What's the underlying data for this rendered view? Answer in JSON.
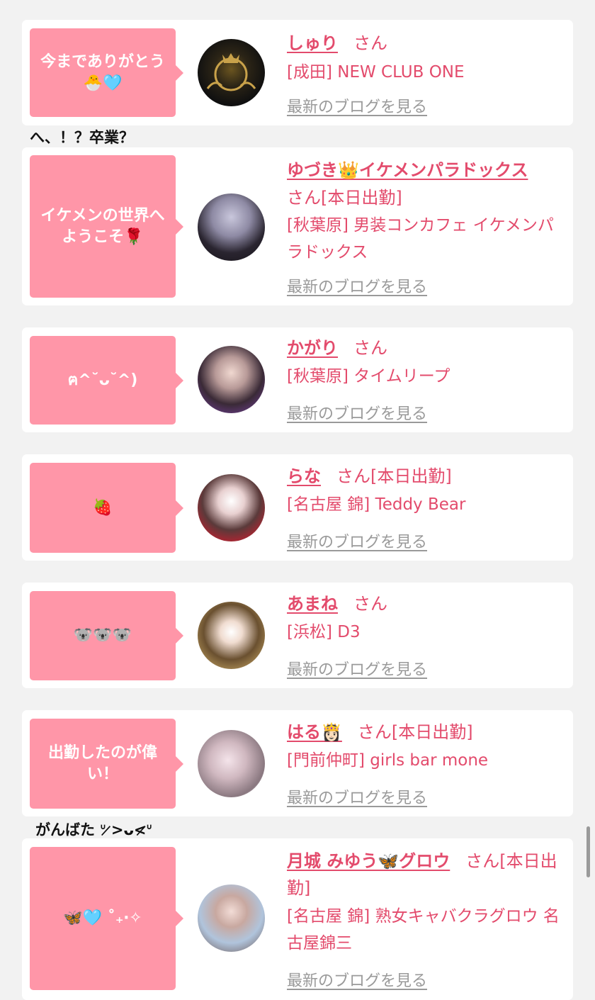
{
  "entries": [
    {
      "message": "今までありがとう🐣🩵",
      "name": "しゅり",
      "san": "さん",
      "shop": "[成田] NEW CLUB ONE",
      "blog": "最新のブログを見る"
    },
    {
      "message": "イケメンの世界へようこそ🌹",
      "name": "ゆづき👑イケメンパラドックス",
      "san": "さん[本日出勤]",
      "shop": "[秋葉原] 男装コンカフェ イケメンパラドックス",
      "blog": "最新のブログを見る"
    },
    {
      "message": "ฅ^˘ᴗ˘^)",
      "name": "かがり",
      "san": "さん",
      "shop": "[秋葉原] タイムリープ",
      "blog": "最新のブログを見る"
    },
    {
      "message": "🍓",
      "name": "らな",
      "san": "さん[本日出勤]",
      "shop": "[名古屋 錦] Teddy Bear",
      "blog": "最新のブログを見る"
    },
    {
      "message": "🐨🐨🐨",
      "name": "あまね",
      "san": "さん",
      "shop": "[浜松] D3",
      "blog": "最新のブログを見る"
    },
    {
      "message": "出勤したのが偉い！",
      "name": "はる👸🏻",
      "san": "さん[本日出勤]",
      "shop": "[門前仲町] girls bar mone",
      "blog": "最新のブログを見る"
    },
    {
      "message": "🦋🩵 ˚₊‧✧",
      "name": "月城 みゆう🦋グロウ",
      "san": "さん[本日出勤]",
      "shop": "[名古屋 錦] 熟女キャバクラグロウ 名古屋錦三",
      "blog": "最新のブログを見る"
    }
  ],
  "comments": {
    "after_first": "へ、！？卒業？",
    "after_sixth": "がんばた ᐡ ̷̷>ᴗ<̷̷ᐡ"
  },
  "colors": {
    "bubble": "#ff96a8",
    "accent": "#e34b6c",
    "link_gray": "#9a9a9a",
    "page_bg": "#f2f2f2"
  }
}
